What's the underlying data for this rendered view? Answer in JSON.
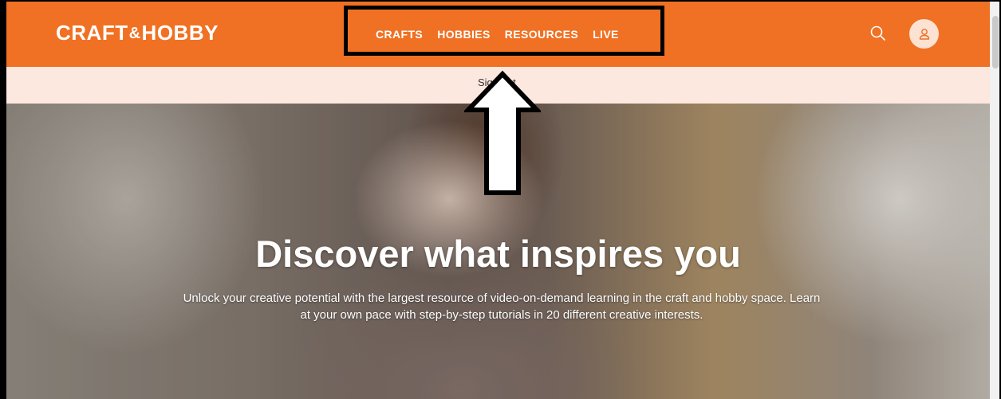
{
  "header": {
    "logo_left": "CRAFT",
    "logo_amp": "&",
    "logo_right": "HOBBY",
    "nav": [
      "CRAFTS",
      "HOBBIES",
      "RESOURCES",
      "LIVE"
    ],
    "search_icon": "search-icon",
    "avatar_icon": "user-icon"
  },
  "banner": {
    "text": "Sign out"
  },
  "hero": {
    "title": "Discover what inspires you",
    "subtitle": "Unlock your creative potential with the largest resource of video-on-demand learning in the craft and hobby space. Learn at your own pace with step-by-step tutorials in 20 different creative interests."
  },
  "annotations": {
    "highlight": "highlight-box",
    "arrow": "up-arrow-icon"
  },
  "colors": {
    "brand_orange": "#f07124",
    "banner_bg": "#fde8df",
    "avatar_bg": "#fbe2d2"
  }
}
